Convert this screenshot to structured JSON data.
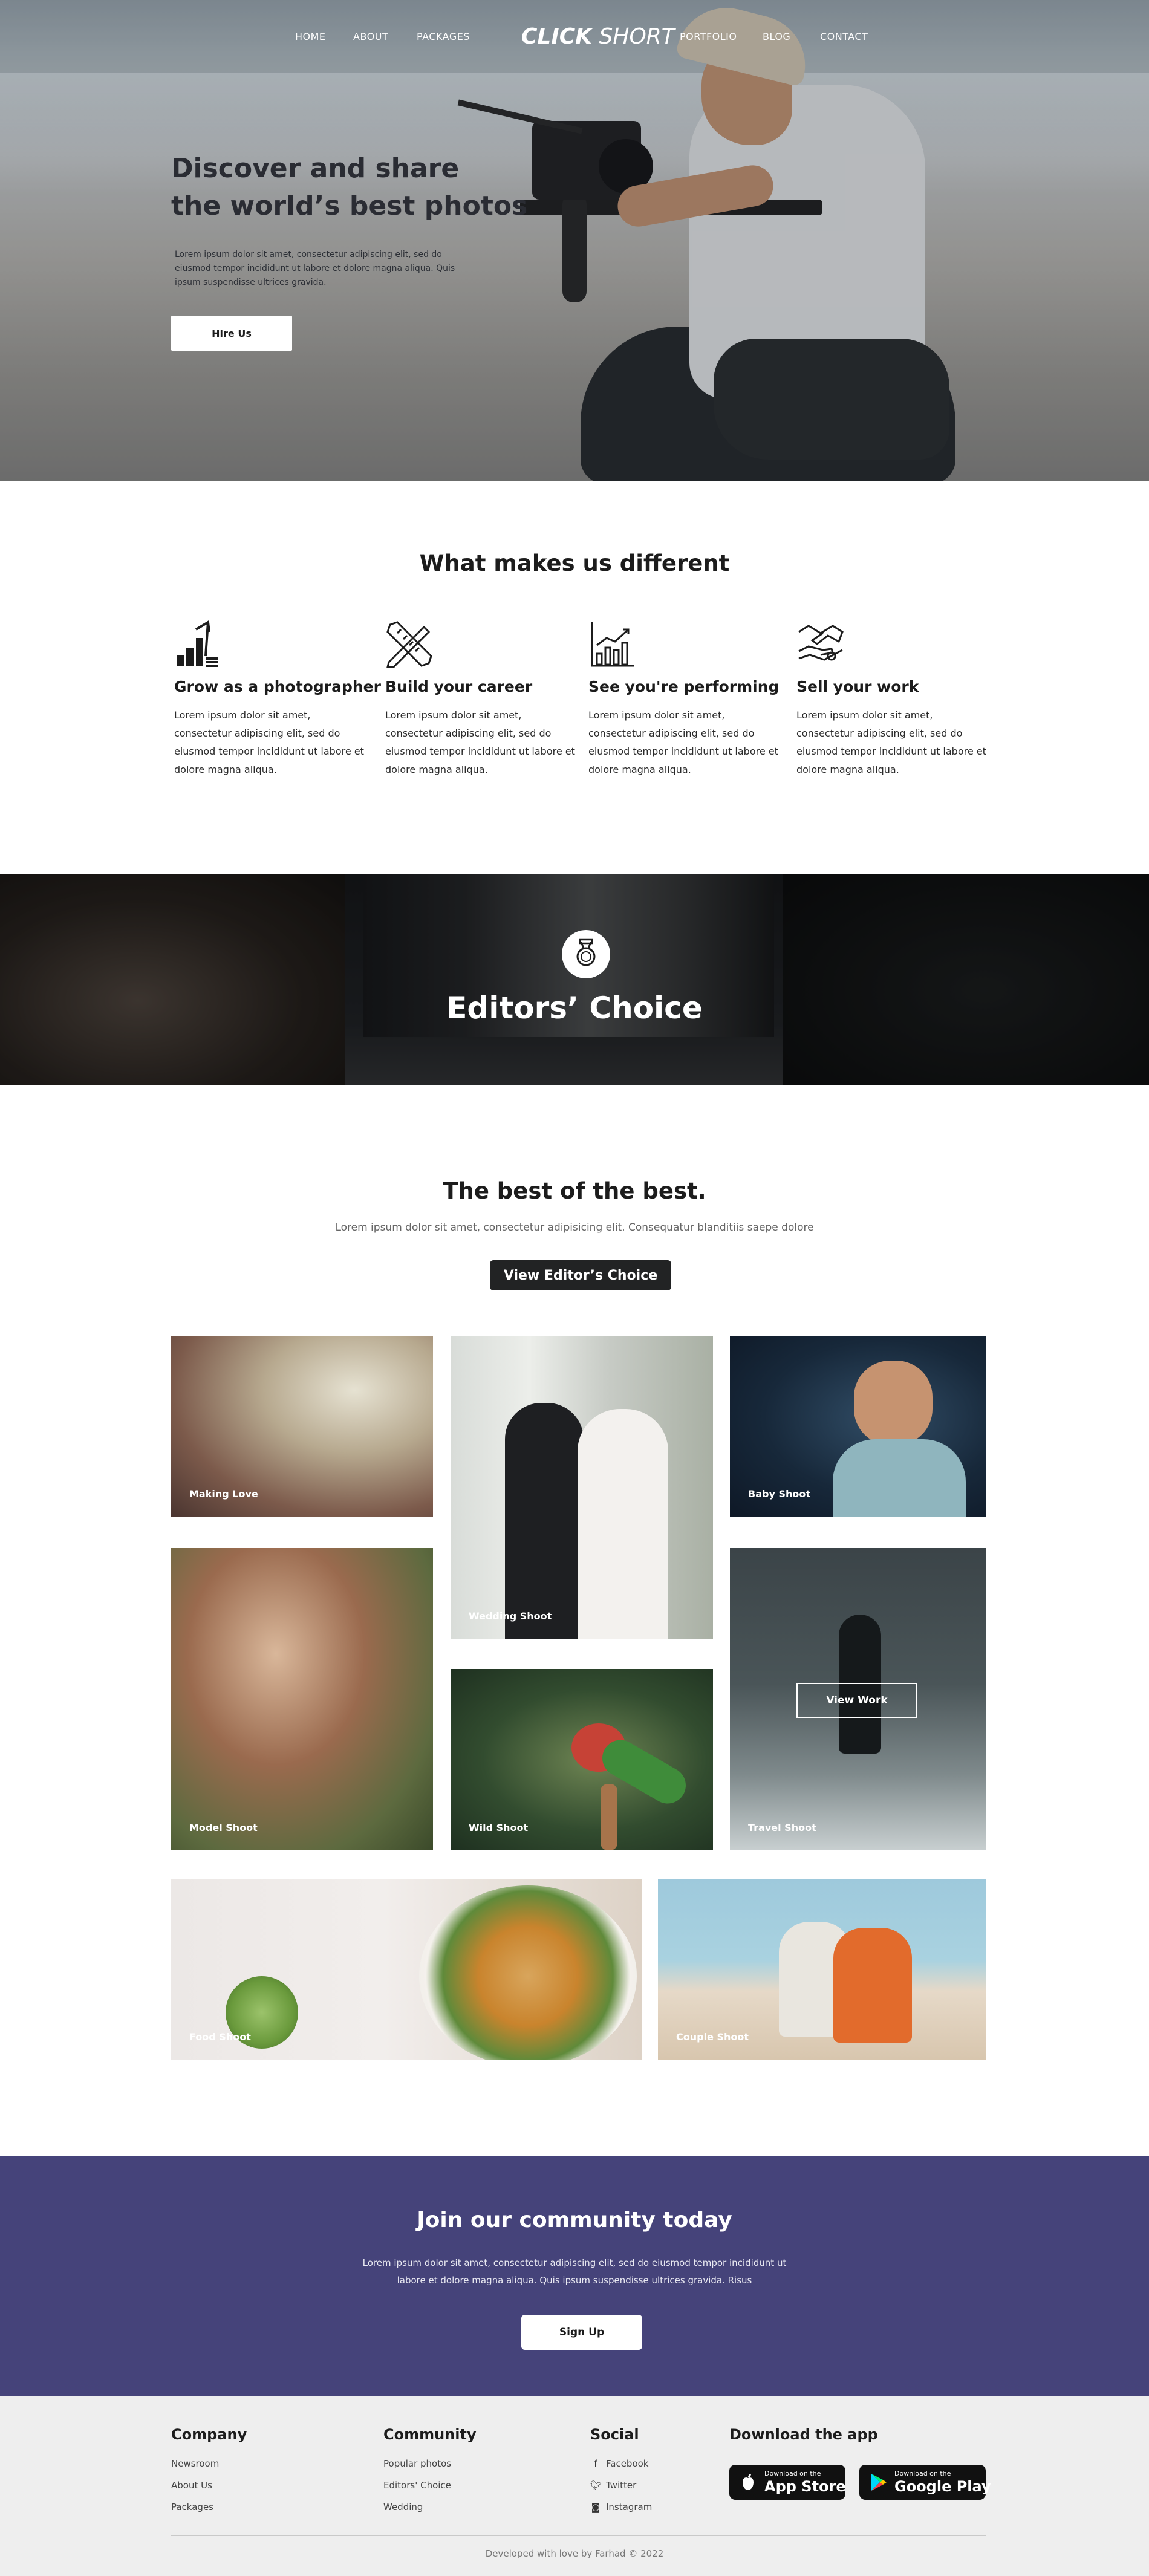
{
  "nav": {
    "links_left": [
      "HOME",
      "ABOUT",
      "PACKAGES"
    ],
    "logo_bold": "CLICK",
    "logo_light": "SHORT",
    "links_right": [
      "PORTFOLIO",
      "BLOG",
      "CONTACT"
    ]
  },
  "hero": {
    "title_line1": "Discover and share",
    "title_line2": "the world’s best photos",
    "text": "Lorem ipsum dolor sit amet, consectetur adipiscing elit, sed do eiusmod tempor incididunt ut labore et dolore magna aliqua. Quis ipsum suspendisse ultrices gravida.",
    "button": "Hire Us"
  },
  "different": {
    "title": "What makes us different",
    "features": [
      {
        "icon": "growth-bars-icon",
        "title": "Grow as a photographer",
        "text": "Lorem ipsum dolor sit amet, consectetur adipiscing elit, sed do eiusmod tempor incididunt ut labore et dolore magna aliqua."
      },
      {
        "icon": "pencil-ruler-icon",
        "title": "Build your career",
        "text": "Lorem ipsum dolor sit amet, consectetur adipiscing elit, sed do eiusmod tempor incididunt ut labore et dolore magna aliqua."
      },
      {
        "icon": "chart-icon",
        "title": "See you're performing",
        "text": "Lorem ipsum dolor sit amet, consectetur adipiscing elit, sed do eiusmod tempor incididunt ut labore et dolore magna aliqua."
      },
      {
        "icon": "handshake-icon",
        "title": "Sell your work",
        "text": "Lorem ipsum dolor sit amet, consectetur adipiscing elit, sed do eiusmod tempor incididunt ut labore et dolore magna aliqua."
      }
    ]
  },
  "editors_band": {
    "title": "Editors’ Choice",
    "icon": "medal-icon"
  },
  "best": {
    "title": "The best of the best.",
    "subtitle": "Lorem ipsum dolor sit amet, consectetur adipisicing elit. Consequatur blanditiis saepe dolore",
    "button": "View Editor’s Choice"
  },
  "gallery": {
    "making_love": "Making Love",
    "wedding": "Wedding Shoot",
    "baby": "Baby Shoot",
    "model": "Model Shoot",
    "wild": "Wild Shoot",
    "travel": "Travel Shoot",
    "travel_button": "View Work",
    "food": "Food Shoot",
    "couple": "Couple Shoot"
  },
  "join": {
    "title": "Join our community today",
    "text": "Lorem ipsum dolor sit amet, consectetur adipiscing elit, sed do eiusmod tempor incididunt ut labore et dolore magna aliqua. Quis ipsum suspendisse ultrices gravida. Risus",
    "button": "Sign Up"
  },
  "footer": {
    "company": {
      "title": "Company",
      "items": [
        "Newsroom",
        "About Us",
        "Packages"
      ]
    },
    "community": {
      "title": "Community",
      "items": [
        "Popular photos",
        "Editors' Choice",
        "Wedding"
      ]
    },
    "social": {
      "title": "Social",
      "items": [
        {
          "icon": "facebook-icon",
          "label": "Facebook"
        },
        {
          "icon": "twitter-icon",
          "label": "Twitter"
        },
        {
          "icon": "instagram-icon",
          "label": "Instagram"
        }
      ]
    },
    "app": {
      "title": "Download the app",
      "appstore_small": "Download on the",
      "appstore_big": "App Store",
      "googleplay_small": "Download on the",
      "googleplay_big": "Google Play"
    },
    "credit": "Developed with love by Farhad © 2022"
  },
  "colors": {
    "join_bg": "#45437a",
    "footer_bg": "#eeeeee",
    "button_dark": "#222324"
  }
}
